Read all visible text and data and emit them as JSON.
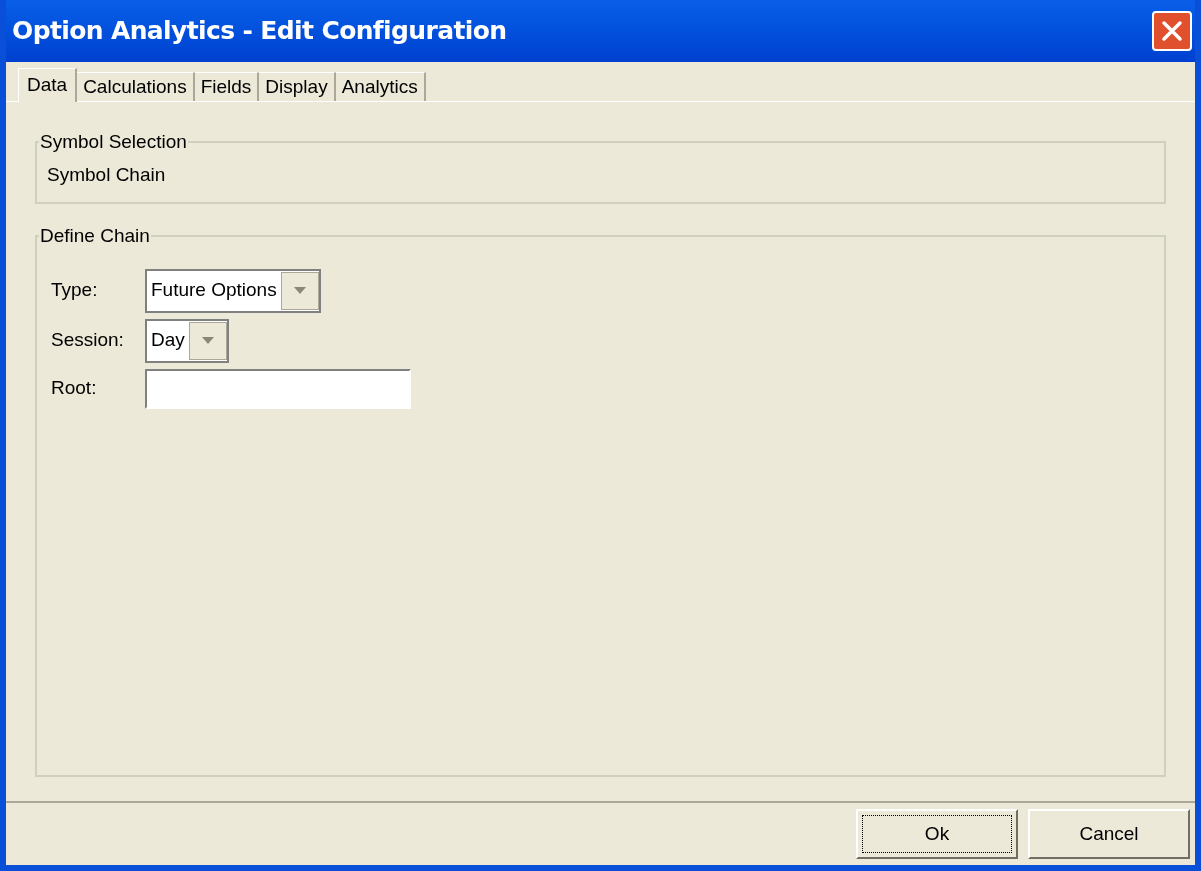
{
  "window": {
    "title": "Option Analytics - Edit Configuration"
  },
  "tabs": [
    {
      "label": "Data",
      "selected": true
    },
    {
      "label": "Calculations",
      "selected": false
    },
    {
      "label": "Fields",
      "selected": false
    },
    {
      "label": "Display",
      "selected": false
    },
    {
      "label": "Analytics",
      "selected": false
    }
  ],
  "symbol_selection": {
    "title": "Symbol Selection",
    "value": "Symbol Chain"
  },
  "define_chain": {
    "title": "Define Chain",
    "fields": [
      {
        "kind": "dropdown",
        "label": "Type:",
        "value": "Future Options"
      },
      {
        "kind": "dropdown",
        "label": "Session:",
        "value": "Day"
      },
      {
        "kind": "text",
        "label": "Root:"
      }
    ]
  },
  "buttons": [
    {
      "label": "Ok",
      "focused": true
    },
    {
      "label": "Cancel",
      "focused": false
    }
  ]
}
